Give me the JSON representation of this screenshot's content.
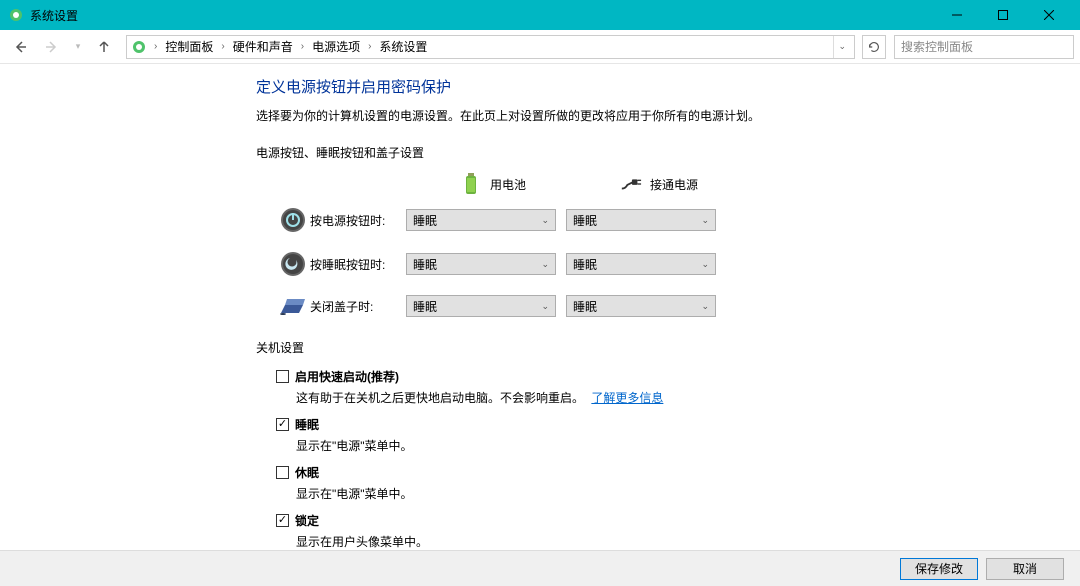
{
  "window": {
    "title": "系统设置"
  },
  "nav": {
    "breadcrumbs": [
      "控制面板",
      "硬件和声音",
      "电源选项",
      "系统设置"
    ],
    "search_placeholder": "搜索控制面板"
  },
  "page": {
    "title": "定义电源按钮并启用密码保护",
    "description": "选择要为你的计算机设置的电源设置。在此页上对设置所做的更改将应用于你所有的电源计划。"
  },
  "power_section": {
    "heading": "电源按钮、睡眠按钮和盖子设置",
    "col_battery": "用电池",
    "col_plugged": "接通电源",
    "rows": [
      {
        "icon": "power-icon",
        "label": "按电源按钮时:",
        "battery": "睡眠",
        "plugged": "睡眠"
      },
      {
        "icon": "sleep-icon",
        "label": "按睡眠按钮时:",
        "battery": "睡眠",
        "plugged": "睡眠"
      },
      {
        "icon": "lid-icon",
        "label": "关闭盖子时:",
        "battery": "睡眠",
        "plugged": "睡眠"
      }
    ]
  },
  "shutdown_section": {
    "heading": "关机设置",
    "items": [
      {
        "checked": false,
        "label": "启用快速启动(推荐)",
        "desc": "这有助于在关机之后更快地启动电脑。不会影响重启。",
        "link": "了解更多信息"
      },
      {
        "checked": true,
        "label": "睡眠",
        "desc": "显示在\"电源\"菜单中。"
      },
      {
        "checked": false,
        "label": "休眠",
        "desc": "显示在\"电源\"菜单中。"
      },
      {
        "checked": true,
        "label": "锁定",
        "desc": "显示在用户头像菜单中。"
      }
    ]
  },
  "footer": {
    "save": "保存修改",
    "cancel": "取消"
  }
}
